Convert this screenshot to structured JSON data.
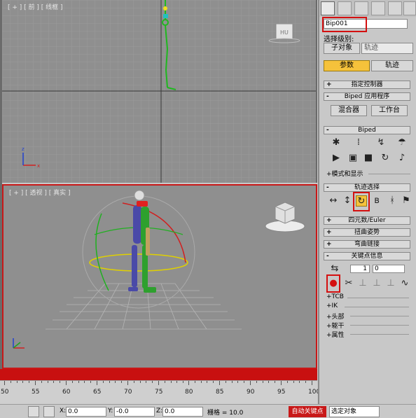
{
  "viewports": {
    "front_label": "[ + ] [ 前 ] [ 线框 ]",
    "persp_label": "[ + ] [ 透视 ] [ 真实 ]",
    "viewcube_front": "前",
    "viewcube_persp": "前"
  },
  "timeline": {
    "ticks": [
      "50",
      "55",
      "60",
      "65",
      "70",
      "75",
      "80",
      "85",
      "90",
      "95",
      "100"
    ]
  },
  "statusbar": {
    "x_label": "X:",
    "x_value": "0.0",
    "y_label": "Y:",
    "y_value": "-0.0",
    "z_label": "Z:",
    "z_value": "0.0",
    "grid_label": "栅格 = 10.0",
    "autokey_label": "自动关键点",
    "selected_label": "选定对象"
  },
  "panel": {
    "object_name": "Bip001",
    "selection_level_label": "选择级别:",
    "sub_object_button": "子对象",
    "sub_object_dropdown": "轨迹",
    "tab_params": "参数",
    "tab_tracks": "轨迹",
    "rollouts": {
      "assign_controller": "指定控制器",
      "biped_apps": "Biped 应用程序",
      "biped": "Biped",
      "track_selection": "轨迹选择",
      "quaternion_euler": "四元数/Euler",
      "twist_poses": "扭曲姿势",
      "bend_links": "弯曲链接",
      "key_info": "关键点信息"
    },
    "mixer_button": "混合器",
    "workbench_button": "工作台",
    "modes_display": "+模式和显示",
    "key_number": "1",
    "key_time": "0",
    "subrows": [
      "+TCB",
      "+IK",
      "+头部",
      "+躯干",
      "+属性"
    ]
  }
}
